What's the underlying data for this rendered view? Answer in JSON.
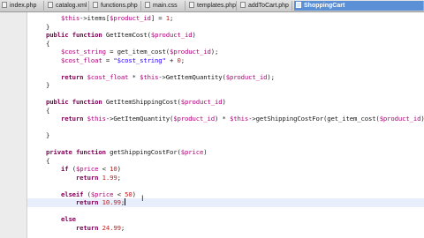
{
  "tabs": [
    {
      "label": "index.php",
      "active": false
    },
    {
      "label": "catalog.xml",
      "active": false
    },
    {
      "label": "functions.php",
      "active": false
    },
    {
      "label": "main.css",
      "active": false
    },
    {
      "label": "templates.php",
      "active": false
    },
    {
      "label": "addToCart.php",
      "active": false
    },
    {
      "label": "ShoppingCart",
      "active": true
    }
  ],
  "lines": [
    {
      "num": "",
      "code": "        $this->items[$product_id] = 1;"
    },
    {
      "num": "17",
      "code": "    }"
    },
    {
      "num": "18",
      "code": "    public function GetItemCost($product_id)"
    },
    {
      "num": "19",
      "code": "    {"
    },
    {
      "num": "20",
      "code": "        $cost_string = get_item_cost($product_id);"
    },
    {
      "num": "21",
      "code": "        $cost_float = \"$cost_string\" + 0;"
    },
    {
      "num": "22",
      "code": ""
    },
    {
      "num": "23",
      "code": "        return $cost_float * $this->GetItemQuantity($product_id);"
    },
    {
      "num": "24",
      "code": "    }"
    },
    {
      "num": "25",
      "code": ""
    },
    {
      "num": "26",
      "code": "    public function GetItemShippingCost($product_id)"
    },
    {
      "num": "27",
      "code": "    {"
    },
    {
      "num": "28",
      "code": "        return $this->GetItemQuantity($product_id) * $this->getShippingCostFor(get_item_cost($product_id));"
    },
    {
      "num": "29",
      "code": ""
    },
    {
      "num": "30",
      "code": "    }"
    },
    {
      "num": "31",
      "code": ""
    },
    {
      "num": "32",
      "code": "    private function getShippingCostFor($price)"
    },
    {
      "num": "33",
      "code": "    {"
    },
    {
      "num": "34",
      "code": "        if ($price < 10)"
    },
    {
      "num": "35",
      "code": "            return 1.99;"
    },
    {
      "num": "36",
      "code": ""
    },
    {
      "num": "37",
      "code": "        elseif ($price < 50)"
    },
    {
      "num": "38",
      "code": "            return 10.99;"
    },
    {
      "num": "39",
      "code": ""
    },
    {
      "num": "40",
      "code": "        else"
    },
    {
      "num": "41",
      "code": "            return 24.99;"
    }
  ],
  "current_line": "38",
  "fold_markers": [
    "18",
    "26",
    "32"
  ]
}
